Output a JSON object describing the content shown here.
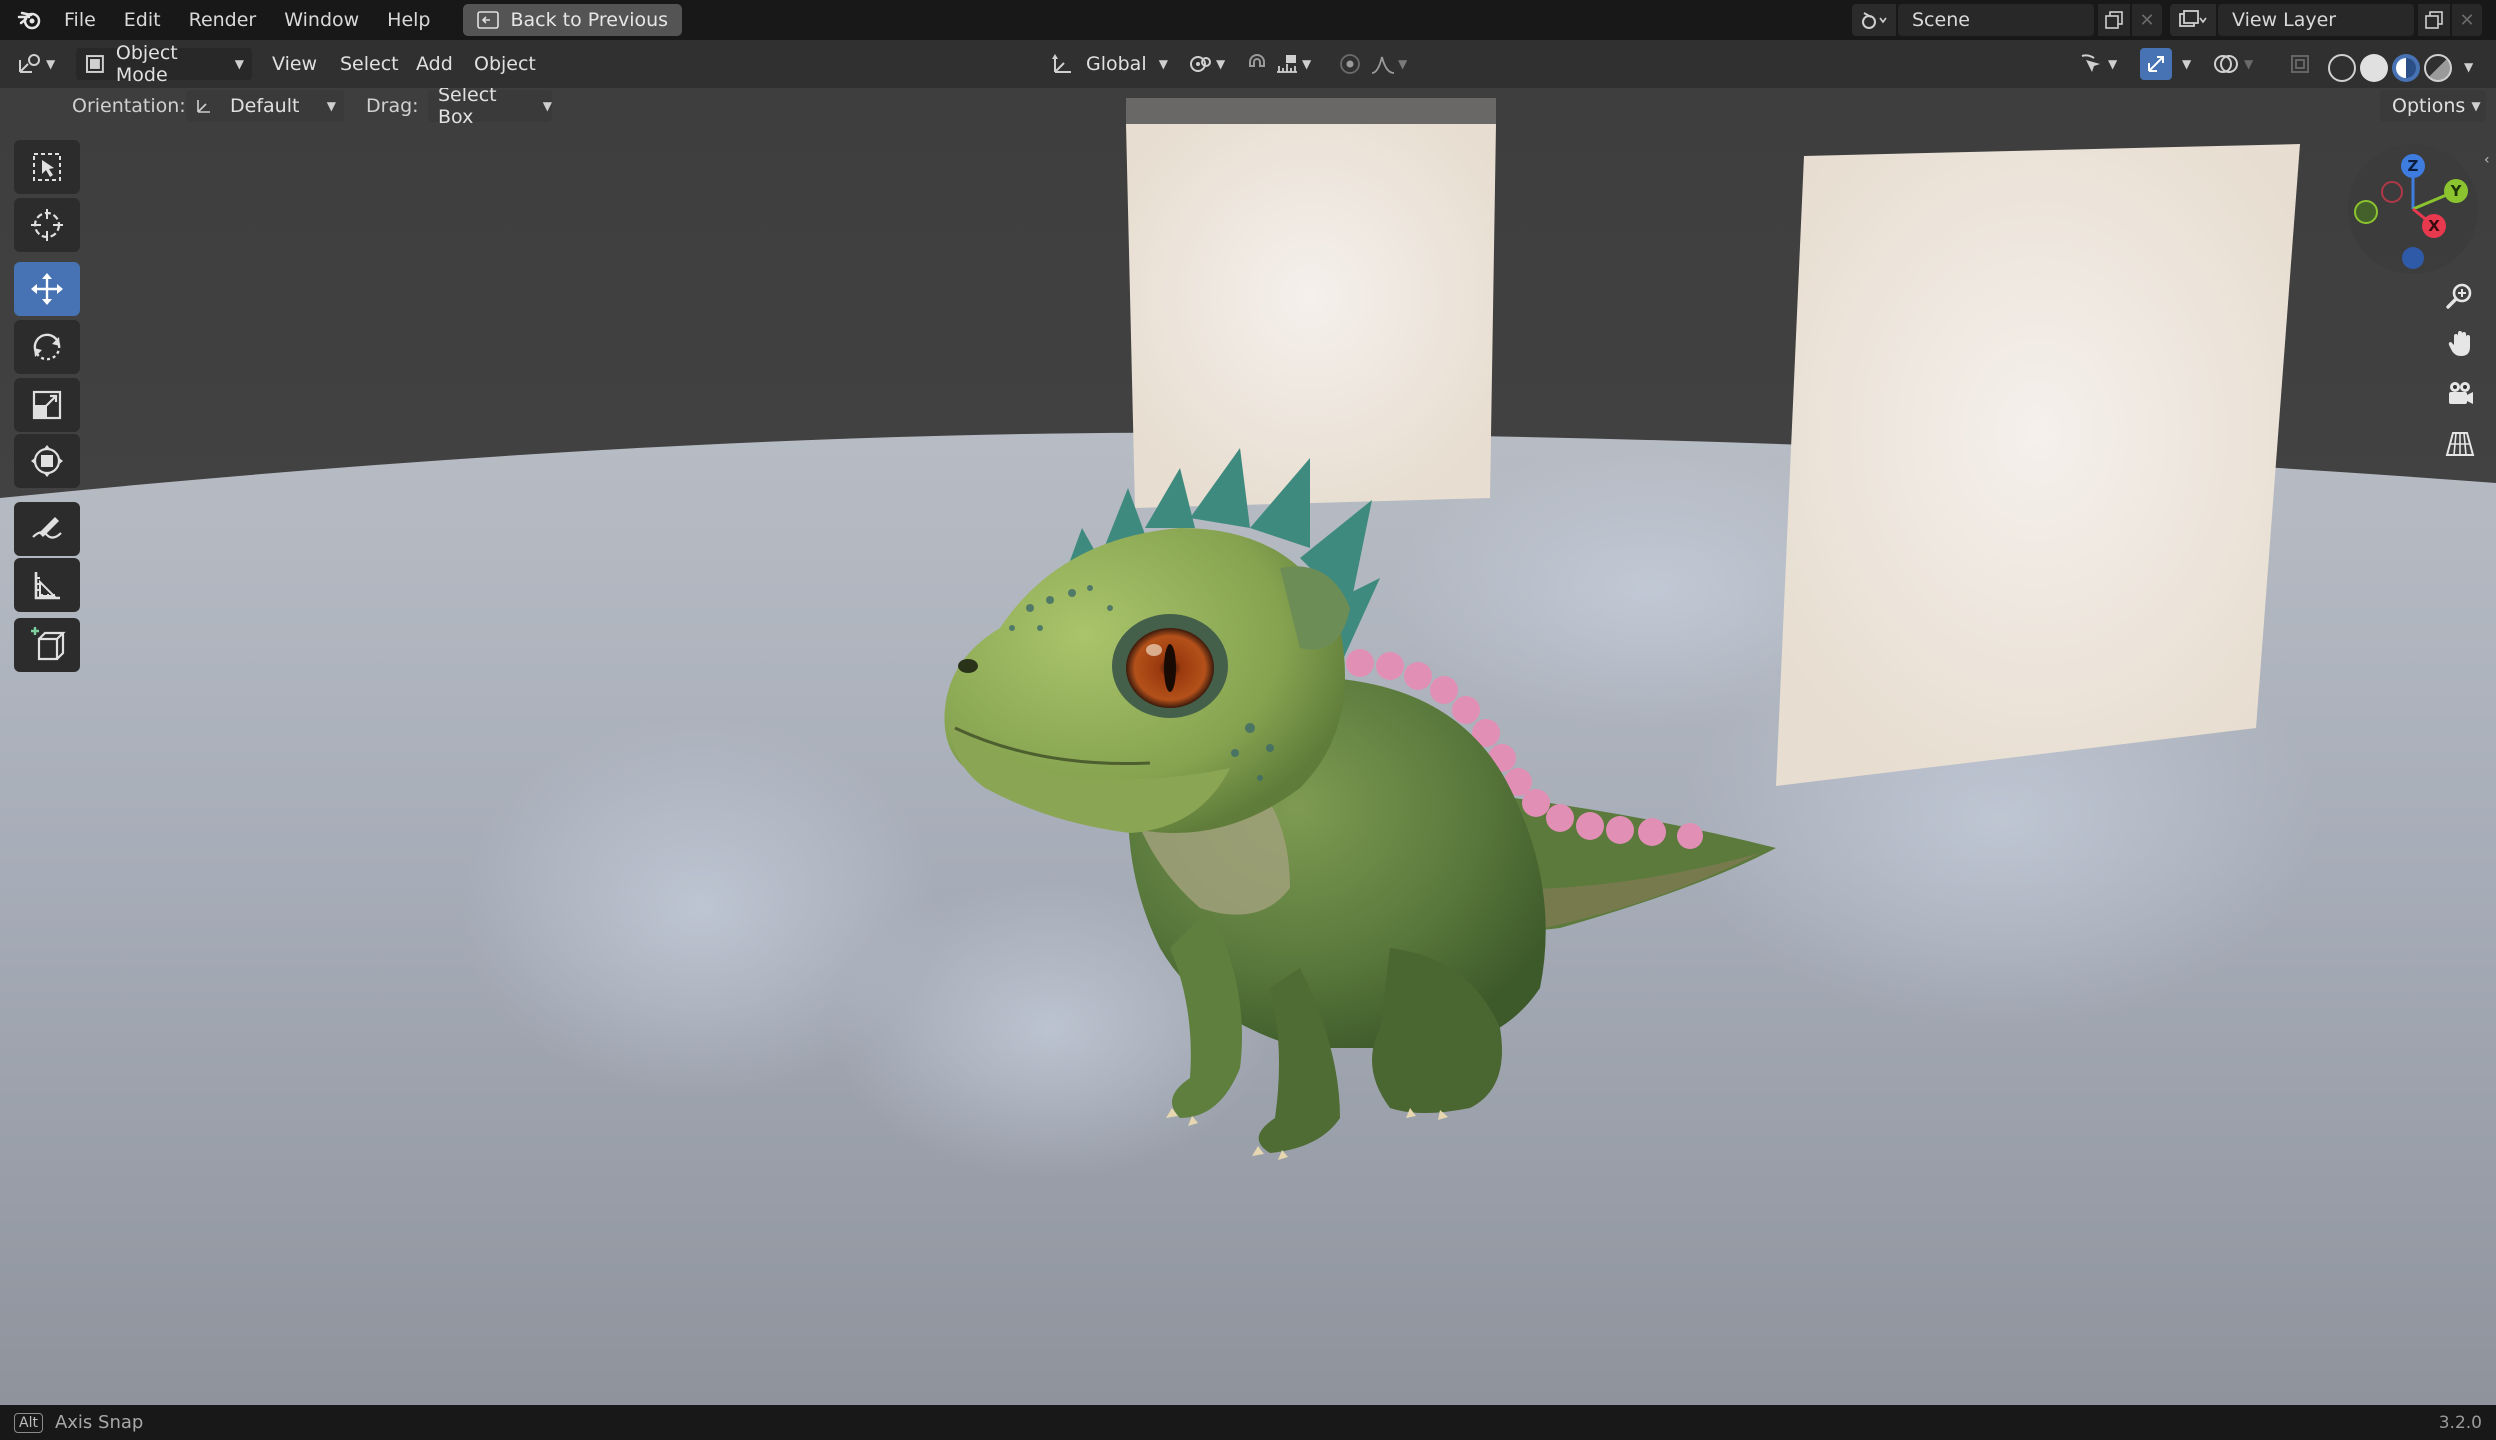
{
  "topbar": {
    "menus": [
      "File",
      "Edit",
      "Render",
      "Window",
      "Help"
    ],
    "back_label": "Back to Previous",
    "scene_label": "Scene",
    "view_layer_label": "View Layer"
  },
  "header": {
    "mode_label": "Object Mode",
    "menus": [
      "View",
      "Select",
      "Add",
      "Object"
    ],
    "transform_orientation": "Global",
    "options_label": "Options"
  },
  "tool_settings": {
    "orientation_label": "Orientation:",
    "orientation_value": "Default",
    "drag_label": "Drag:",
    "drag_value": "Select Box"
  },
  "toolbar": {
    "tools": [
      "select-box",
      "cursor",
      "move",
      "rotate",
      "scale",
      "transform",
      "annotate",
      "measure",
      "add-cube"
    ],
    "active": "move"
  },
  "gizmo": {
    "labels": {
      "z": "Z",
      "y": "Y",
      "x": "X"
    }
  },
  "statusbar": {
    "key_label": "Alt",
    "hint": "Axis Snap",
    "version": "3.2.0"
  },
  "colors": {
    "accent": "#4772b3",
    "axis_x": "#e8394f",
    "axis_y": "#8bc42e",
    "axis_z": "#3f7ce0"
  }
}
